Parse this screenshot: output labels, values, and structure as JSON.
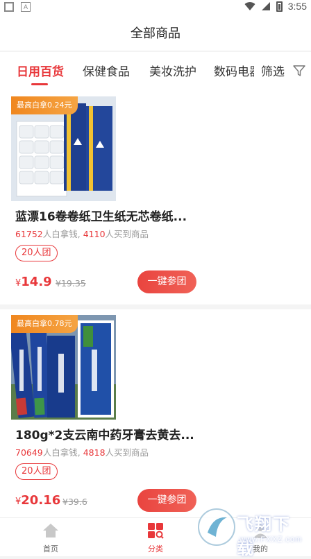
{
  "status_bar": {
    "time": "3:55"
  },
  "header": {
    "title": "全部商品"
  },
  "tabs": [
    {
      "label": "日用百货",
      "active": true
    },
    {
      "label": "保健食品",
      "active": false
    },
    {
      "label": "美妆洗护",
      "active": false
    },
    {
      "label": "数码电器",
      "active": false
    }
  ],
  "filter": {
    "label": "筛选"
  },
  "products": [
    {
      "badge": "最高白拿0.24元",
      "title": "蓝漂16卷卷纸卫生纸无芯卷纸...",
      "sold_cash": "61752",
      "sold_cash_suffix": "人白拿钱, ",
      "sold_goods": "4110",
      "sold_goods_suffix": "人买到商品",
      "group_tag": "20人团",
      "currency": "¥",
      "price": "14.9",
      "original_price": "¥19.35",
      "button": "一键参团"
    },
    {
      "badge": "最高白拿0.78元",
      "title": "180g*2支云南中药牙膏去黄去...",
      "sold_cash": "70649",
      "sold_cash_suffix": "人白拿钱, ",
      "sold_goods": "4818",
      "sold_goods_suffix": "人买到商品",
      "group_tag": "20人团",
      "currency": "¥",
      "price": "20.16",
      "original_price": "¥39.6",
      "button": "一键参团"
    }
  ],
  "bottom_nav": [
    {
      "label": "首页",
      "icon": "home-icon",
      "active": false
    },
    {
      "label": "分类",
      "icon": "category-icon",
      "active": true
    },
    {
      "label": "我的",
      "icon": "profile-icon",
      "active": false
    }
  ],
  "watermark": {
    "text": "飞翔下载",
    "url": "www.FXXZ.com"
  },
  "colors": {
    "accent": "#e8373a",
    "badge": "#f0871f"
  }
}
